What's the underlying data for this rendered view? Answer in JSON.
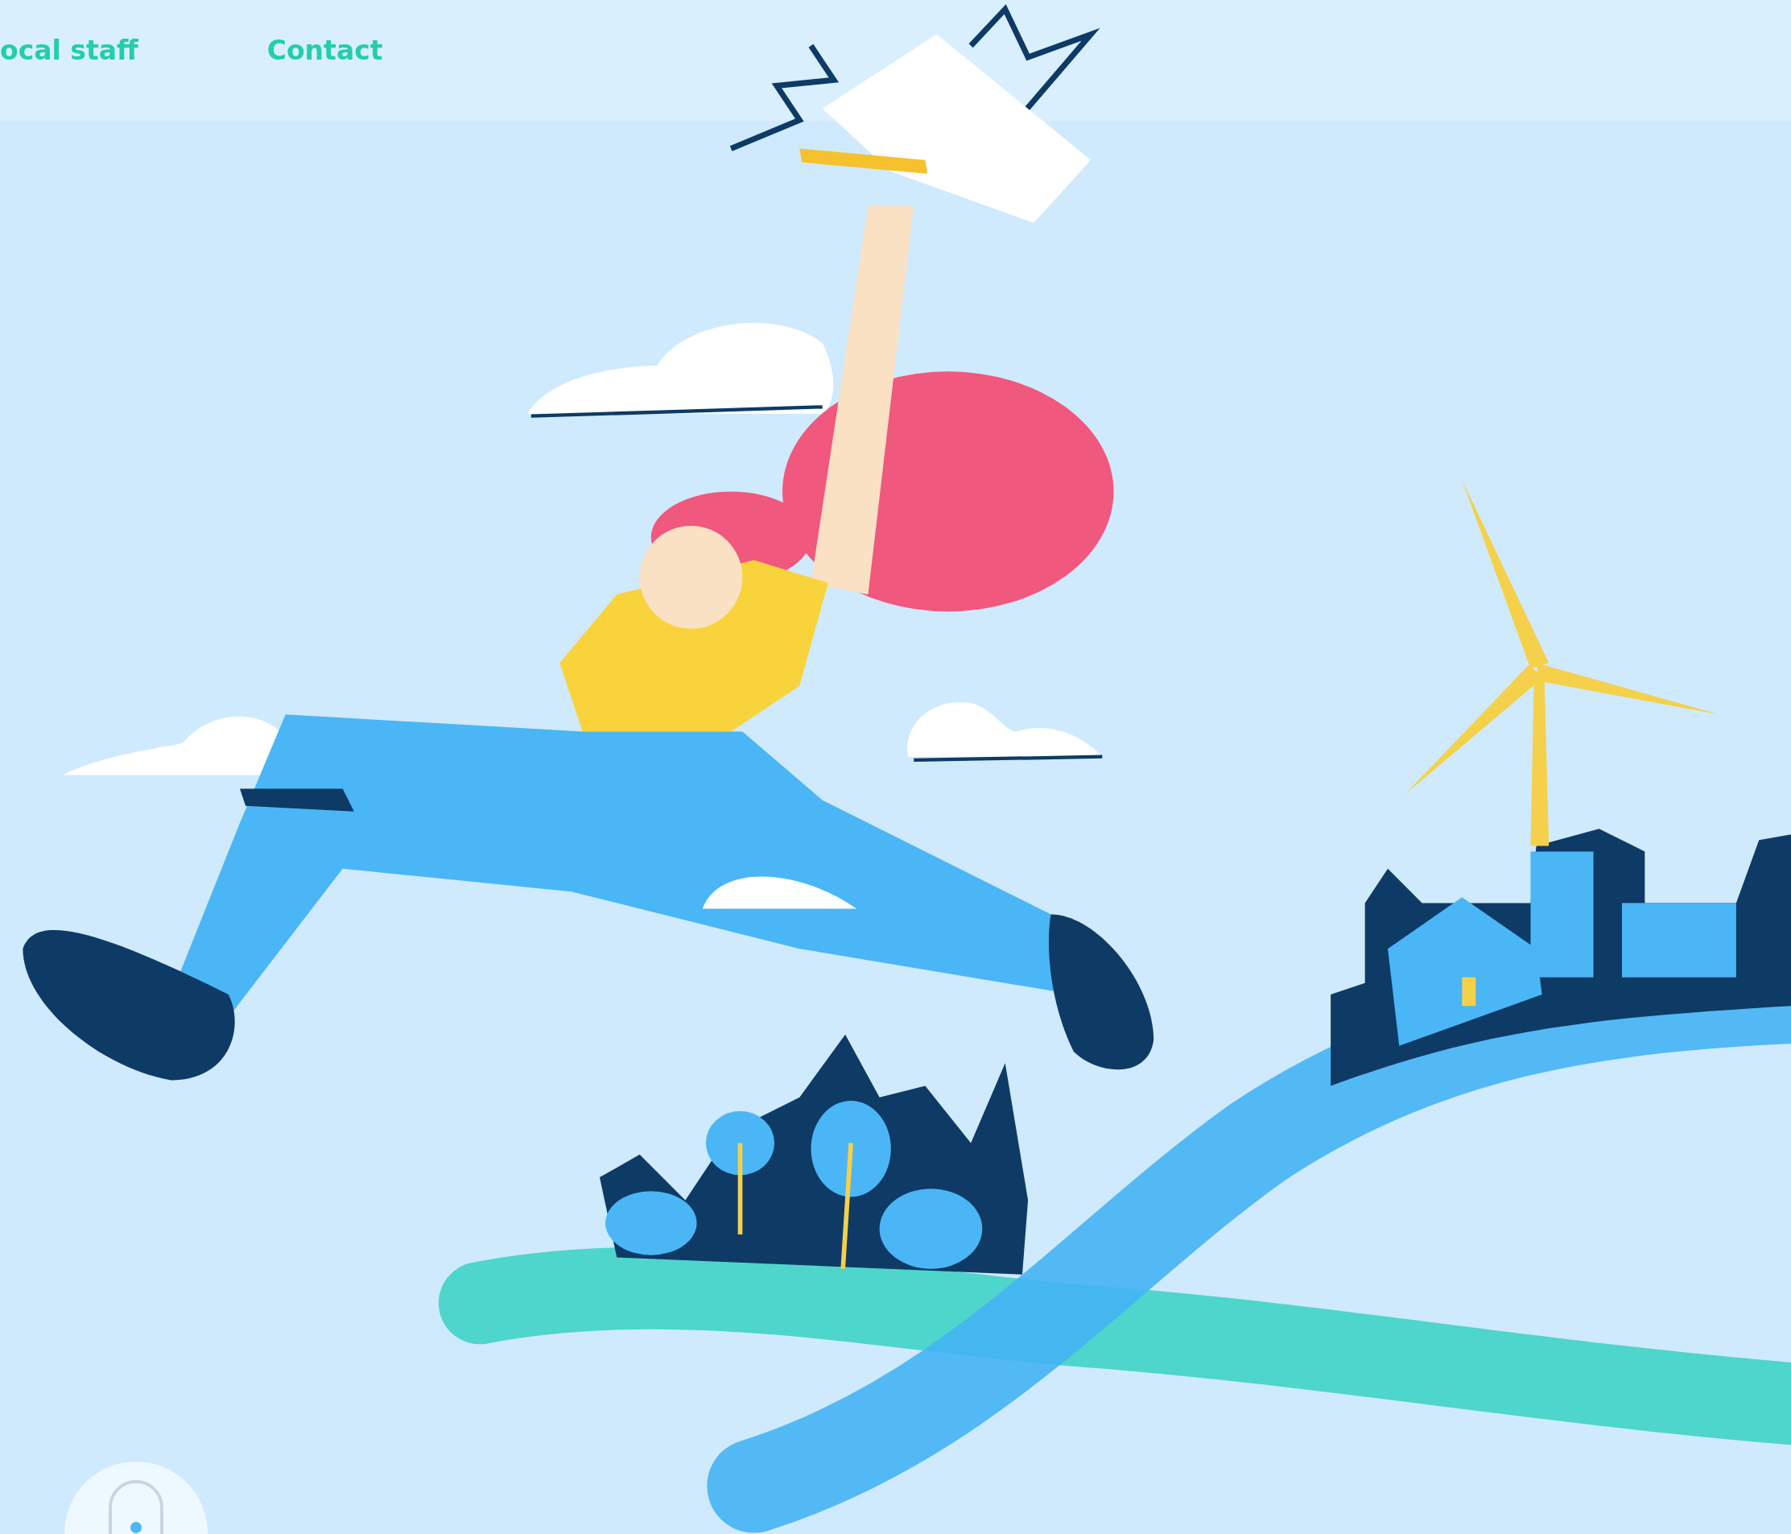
{
  "nav": {
    "links": [
      {
        "label": "ocal staff"
      },
      {
        "label": "Contact"
      }
    ]
  }
}
